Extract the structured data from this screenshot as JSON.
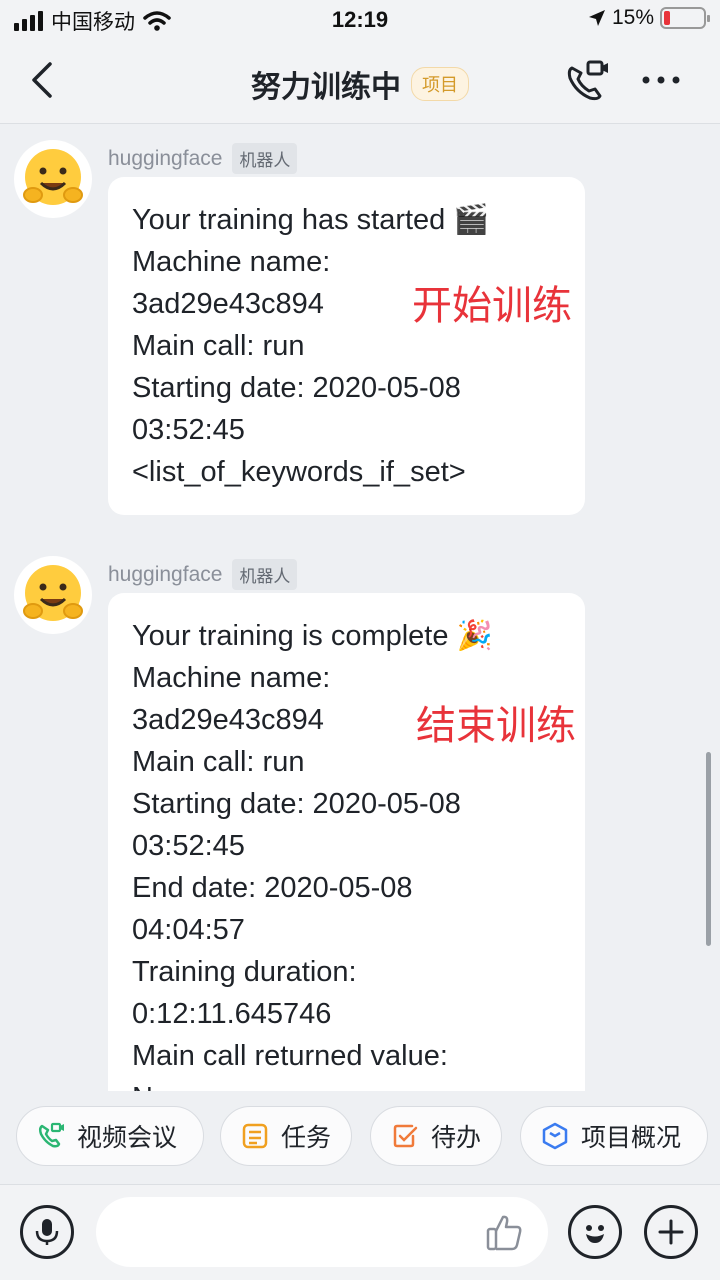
{
  "status_bar": {
    "carrier": "中国移动",
    "time": "12:19",
    "battery": "15%",
    "battery_level": 0.15
  },
  "nav": {
    "title": "努力训练中",
    "tag": "项目",
    "icons": [
      "back-icon",
      "video-call-icon",
      "more-icon"
    ]
  },
  "messages": [
    {
      "sender": "huggingface",
      "tag": "机器人",
      "lines": [
        "Your training has started 🎬",
        "Machine name:",
        "3ad29e43c894",
        "Main call: run",
        "Starting date: 2020-05-08",
        "03:52:45",
        "<list_of_keywords_if_set>"
      ],
      "annotation": "开始训练"
    },
    {
      "sender": "huggingface",
      "tag": "机器人",
      "lines": [
        "Your training is complete 🎉",
        "Machine name:",
        "3ad29e43c894",
        "Main call: run",
        "Starting date: 2020-05-08",
        "03:52:45",
        "End date: 2020-05-08",
        "04:04:57",
        "Training duration:",
        "0:12:11.645746",
        "Main call returned value:",
        "None"
      ],
      "annotation": "结束训练"
    }
  ],
  "quick_actions": [
    {
      "label": "视频会议",
      "icon": "video-meeting-icon",
      "color": "#2bb673"
    },
    {
      "label": "任务",
      "icon": "task-icon",
      "color": "#f0a020"
    },
    {
      "label": "待办",
      "icon": "todo-icon",
      "color": "#f07a3a"
    },
    {
      "label": "项目概况",
      "icon": "project-overview-icon",
      "color": "#3a7bf0"
    }
  ],
  "input": {
    "placeholder": "",
    "icons": [
      "microphone-icon",
      "thumbs-up-icon",
      "emoji-icon",
      "plus-icon"
    ]
  }
}
